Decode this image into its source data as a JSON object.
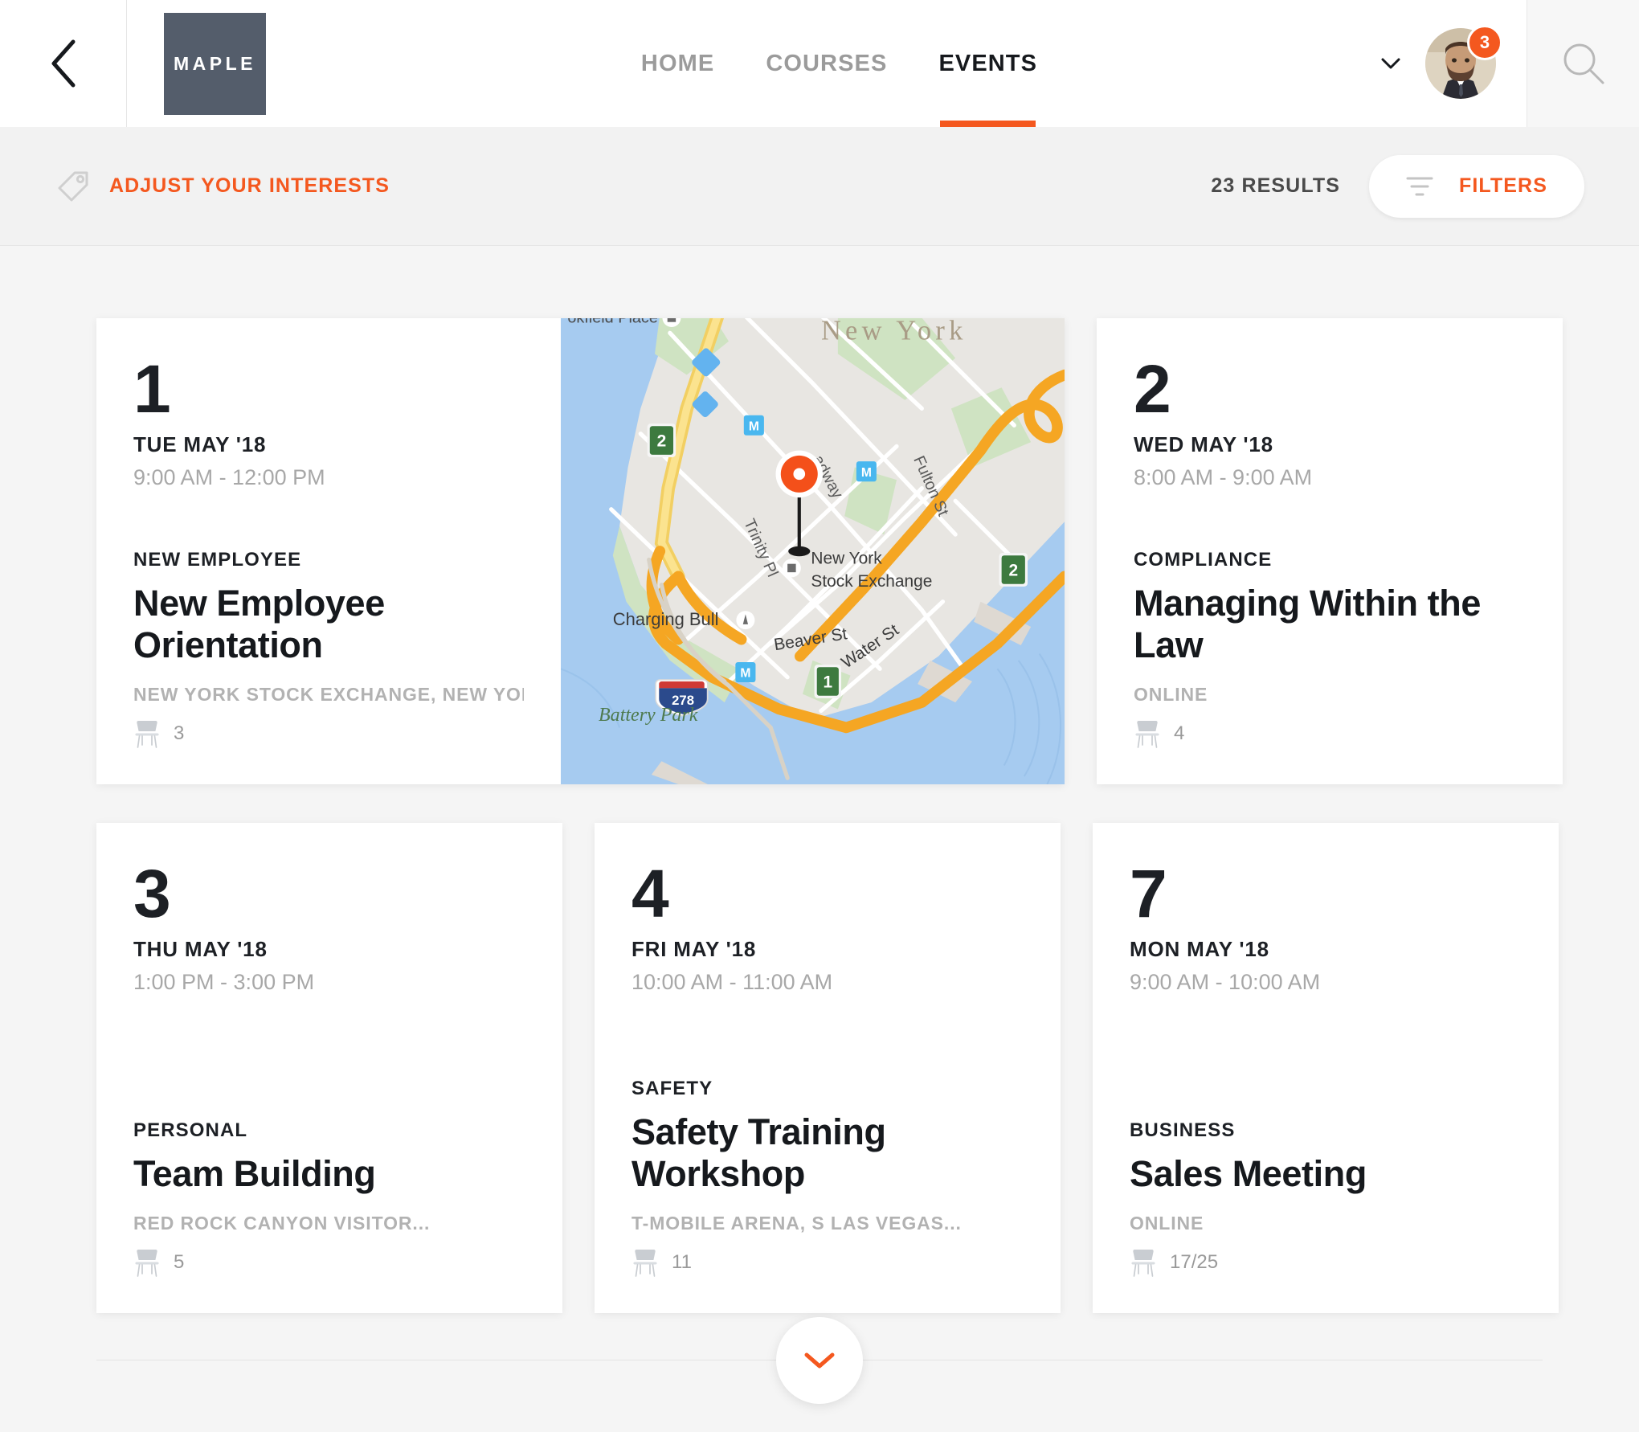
{
  "header": {
    "back_icon": "chevron-left-icon",
    "logo_text": "MAPLE",
    "nav": [
      {
        "label": "HOME",
        "active": false
      },
      {
        "label": "COURSES",
        "active": false
      },
      {
        "label": "EVENTS",
        "active": true
      }
    ],
    "account_caret_icon": "chevron-down-icon",
    "avatar_icon": "user-avatar",
    "notification_count": "3",
    "search_icon": "search-icon",
    "accent_color": "#f4581f",
    "logo_color": "#545d6b"
  },
  "filterbar": {
    "tag_icon": "tag-icon",
    "interests_label": "ADJUST YOUR INTERESTS",
    "results_count": "23 RESULTS",
    "funnel_icon": "filter-funnel-icon",
    "filters_label": "FILTERS"
  },
  "events": [
    {
      "day": "1",
      "date_label": "TUE MAY '18",
      "time": "9:00 AM - 12:00 PM",
      "category": "NEW EMPLOYEE",
      "title": "New Employee Orientation",
      "venue": "NEW YORK STOCK EXCHANGE, NEW YOR...",
      "seats_icon": "chair-icon",
      "seats": "3",
      "has_map": true
    },
    {
      "day": "2",
      "date_label": "WED MAY '18",
      "time": "8:00 AM - 9:00 AM",
      "category": "COMPLIANCE",
      "title": "Managing Within the Law",
      "venue": "ONLINE",
      "seats_icon": "chair-icon",
      "seats": "4",
      "has_map": false
    },
    {
      "day": "3",
      "date_label": "THU MAY '18",
      "time": "1:00 PM - 3:00 PM",
      "category": "PERSONAL",
      "title": "Team Building",
      "venue": "RED ROCK CANYON VISITOR...",
      "seats_icon": "chair-icon",
      "seats": "5",
      "has_map": false
    },
    {
      "day": "4",
      "date_label": "FRI MAY '18",
      "time": "10:00 AM - 11:00 AM",
      "category": "SAFETY",
      "title": "Safety Training Workshop",
      "venue": "T-MOBILE ARENA, S LAS VEGAS...",
      "seats_icon": "chair-icon",
      "seats": "11",
      "has_map": false
    },
    {
      "day": "7",
      "date_label": "MON MAY '18",
      "time": "9:00 AM - 10:00 AM",
      "category": "BUSINESS",
      "title": "Sales Meeting",
      "venue": "ONLINE",
      "seats_icon": "chair-icon",
      "seats": "17/25",
      "has_map": false
    }
  ],
  "map": {
    "pin_icon": "map-pin-marker",
    "labels": {
      "city": "New York",
      "brookfield": "okfield Place",
      "trinity": "Trinity Pl",
      "broadway": "adway",
      "fulton": "Fulton St",
      "nyse_line1": "New York",
      "nyse_line2": "Stock Exchange",
      "charging_bull": "Charging Bull",
      "beaver": "Beaver St",
      "water": "Water St",
      "battery": "Battery Park",
      "route_a": "2",
      "route_b": "2",
      "route_c": "1",
      "interstate": "278",
      "subway": "M"
    }
  },
  "footer": {
    "expand_icon": "chevron-down-icon"
  }
}
